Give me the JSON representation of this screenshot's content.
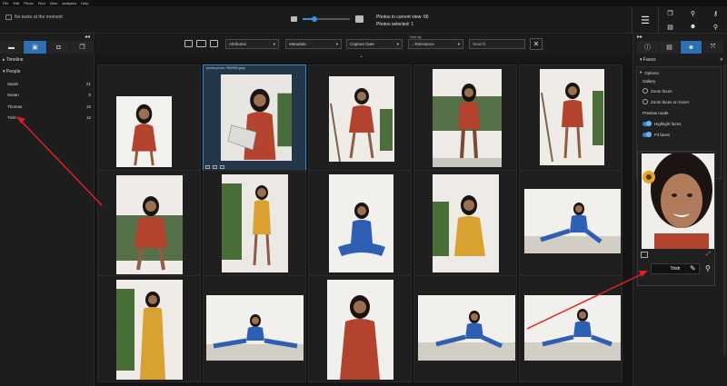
{
  "menu": [
    "File",
    "Edit",
    "Photo",
    "Find",
    "View",
    "Analytics",
    "Help"
  ],
  "status": {
    "text": "No tasks at the moment"
  },
  "zoom": {
    "level": 0.25
  },
  "counts": {
    "in_view": "Photos in current view: 66",
    "selected": "Photos selected: 1"
  },
  "left_panel": {
    "tabs": [
      {
        "icon": "folder-icon",
        "glyph": "▬"
      },
      {
        "icon": "people-calendar-icon",
        "glyph": "▣"
      },
      {
        "icon": "label-icon",
        "glyph": "◘"
      },
      {
        "icon": "albums-icon",
        "glyph": "❐"
      }
    ],
    "timeline": "Timeline",
    "people_header": "People",
    "people": [
      {
        "name": "Sarah",
        "count": "21"
      },
      {
        "name": "Susan",
        "count": "5"
      },
      {
        "name": "Thomas",
        "count": "15"
      },
      {
        "name": "Trish",
        "count": "12"
      }
    ]
  },
  "filters": {
    "attributes": "Attributes",
    "metadata": "Metadata",
    "capture_date": "Capture Date",
    "sort_by_label": "Sort by",
    "sort_value": "↓ Relevance",
    "search_placeholder": "Search"
  },
  "grid": {
    "selected_filename": "pexels-photo-7559983.jpeg"
  },
  "right_panel": {
    "title": "Faces",
    "options_label": "Options",
    "gallery_label": "Gallery",
    "zoom_faces": "Zoom faces",
    "zoom_on_hover": "Zoom faces on hover",
    "preview_mode": "Preview mode",
    "highlight_faces": "Highlight faces",
    "fit_faces": "Fit faces",
    "face_name": "Trish"
  },
  "colors": {
    "accent": "#2c6fb3",
    "arrow": "#e02020"
  }
}
